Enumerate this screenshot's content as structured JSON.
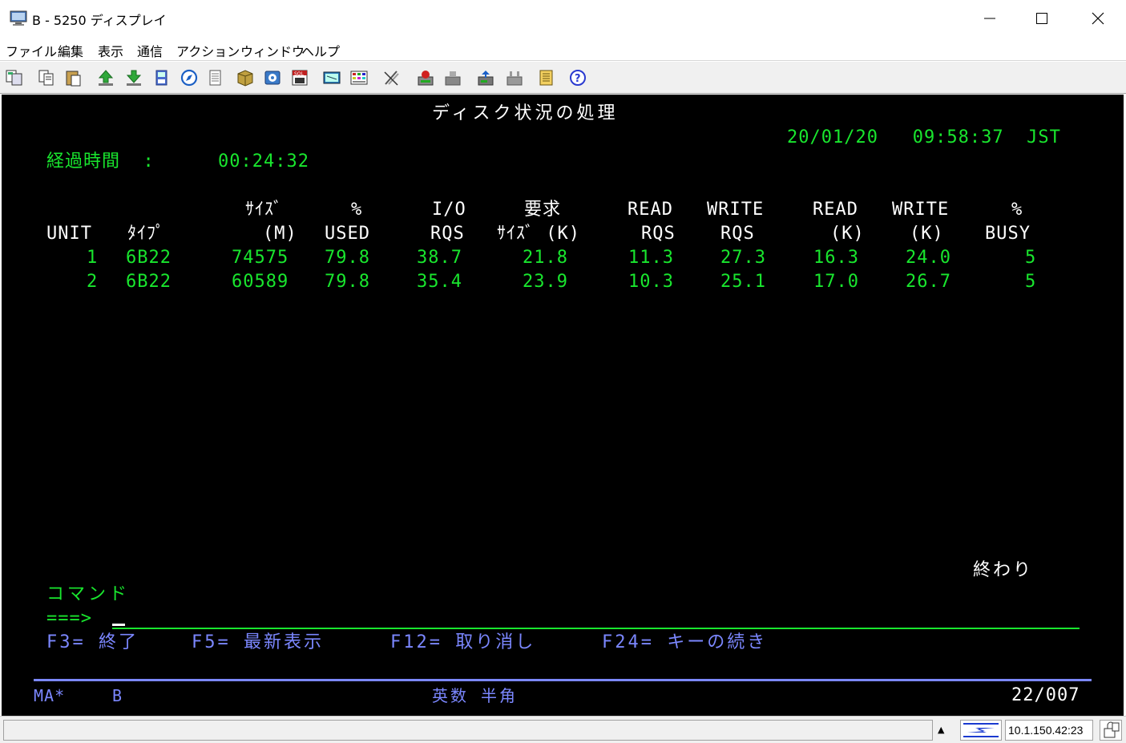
{
  "window": {
    "title": "B - 5250 ディスプレイ",
    "icon": "monitor-icon"
  },
  "menu": [
    "ファイル",
    "編集",
    "表示",
    "通信",
    "アクション",
    "ウィンドウ",
    "ヘルプ"
  ],
  "toolbar": {
    "icons": [
      "copy-icon",
      "copy-append-icon",
      "paste-icon",
      "send-file-icon",
      "receive-file-icon",
      "record-icon",
      "playback-icon",
      "print-screen-icon",
      "macro-icon",
      "keyboard-map-icon",
      "sql-icon",
      "display-options-icon",
      "color-map-icon",
      "tools-icon",
      "start-session-icon",
      "stop-session-icon",
      "connect-icon",
      "disconnect-icon",
      "notes-icon",
      "help-icon"
    ]
  },
  "screen": {
    "title": "ディスク状況の処理",
    "datetime": "20/01/20   09:58:37  JST",
    "elapsed_label": "経過時間  :",
    "elapsed_value": "00:24:32",
    "headers_row1": {
      "size": "ｻｲｽﾞ",
      "used_pct": "%",
      "io": "I/O",
      "request": "要求",
      "read": "READ",
      "write": "WRITE",
      "read_k": "READ",
      "write_k": "WRITE",
      "busy_pct": "%"
    },
    "headers_row2": {
      "unit": "UNIT",
      "type": "ﾀｲﾌﾟ",
      "size": "(M)",
      "used": "USED",
      "rqs": "RQS",
      "req_size": "ｻｲｽﾞ (K)",
      "read_rqs": "RQS",
      "write_rqs": "RQS",
      "read_k": "(K)",
      "write_k": "(K)",
      "busy": "BUSY"
    },
    "rows": [
      {
        "unit": "1",
        "type": "6B22",
        "size": "74575",
        "used": "79.8",
        "io": "38.7",
        "req": "21.8",
        "read": "11.3",
        "write": "27.3",
        "read_k": "16.3",
        "write_k": "24.0",
        "busy": "5"
      },
      {
        "unit": "2",
        "type": "6B22",
        "size": "60589",
        "used": "79.8",
        "io": "35.4",
        "req": "23.9",
        "read": "10.3",
        "write": "25.1",
        "read_k": "17.0",
        "write_k": "26.7",
        "busy": "5"
      }
    ],
    "end_label": "終わり",
    "command_label": "コマンド",
    "prompt": "===>",
    "fkeys": {
      "f3": "F3= 終了",
      "f5": "F5= 最新表示",
      "f12": "F12= 取り消し",
      "f24": "F24= キーの続き"
    },
    "oia": {
      "status": "MA*",
      "session": "B",
      "input_mode": "英数 半角",
      "cursor_pos": "22/007"
    }
  },
  "statusbar": {
    "ip": "10.1.150.42:23"
  },
  "colors": {
    "screen_bg": "#000000",
    "text_green": "#19e62e",
    "text_white": "#ffffff",
    "oia_blue": "#7b87ff"
  }
}
